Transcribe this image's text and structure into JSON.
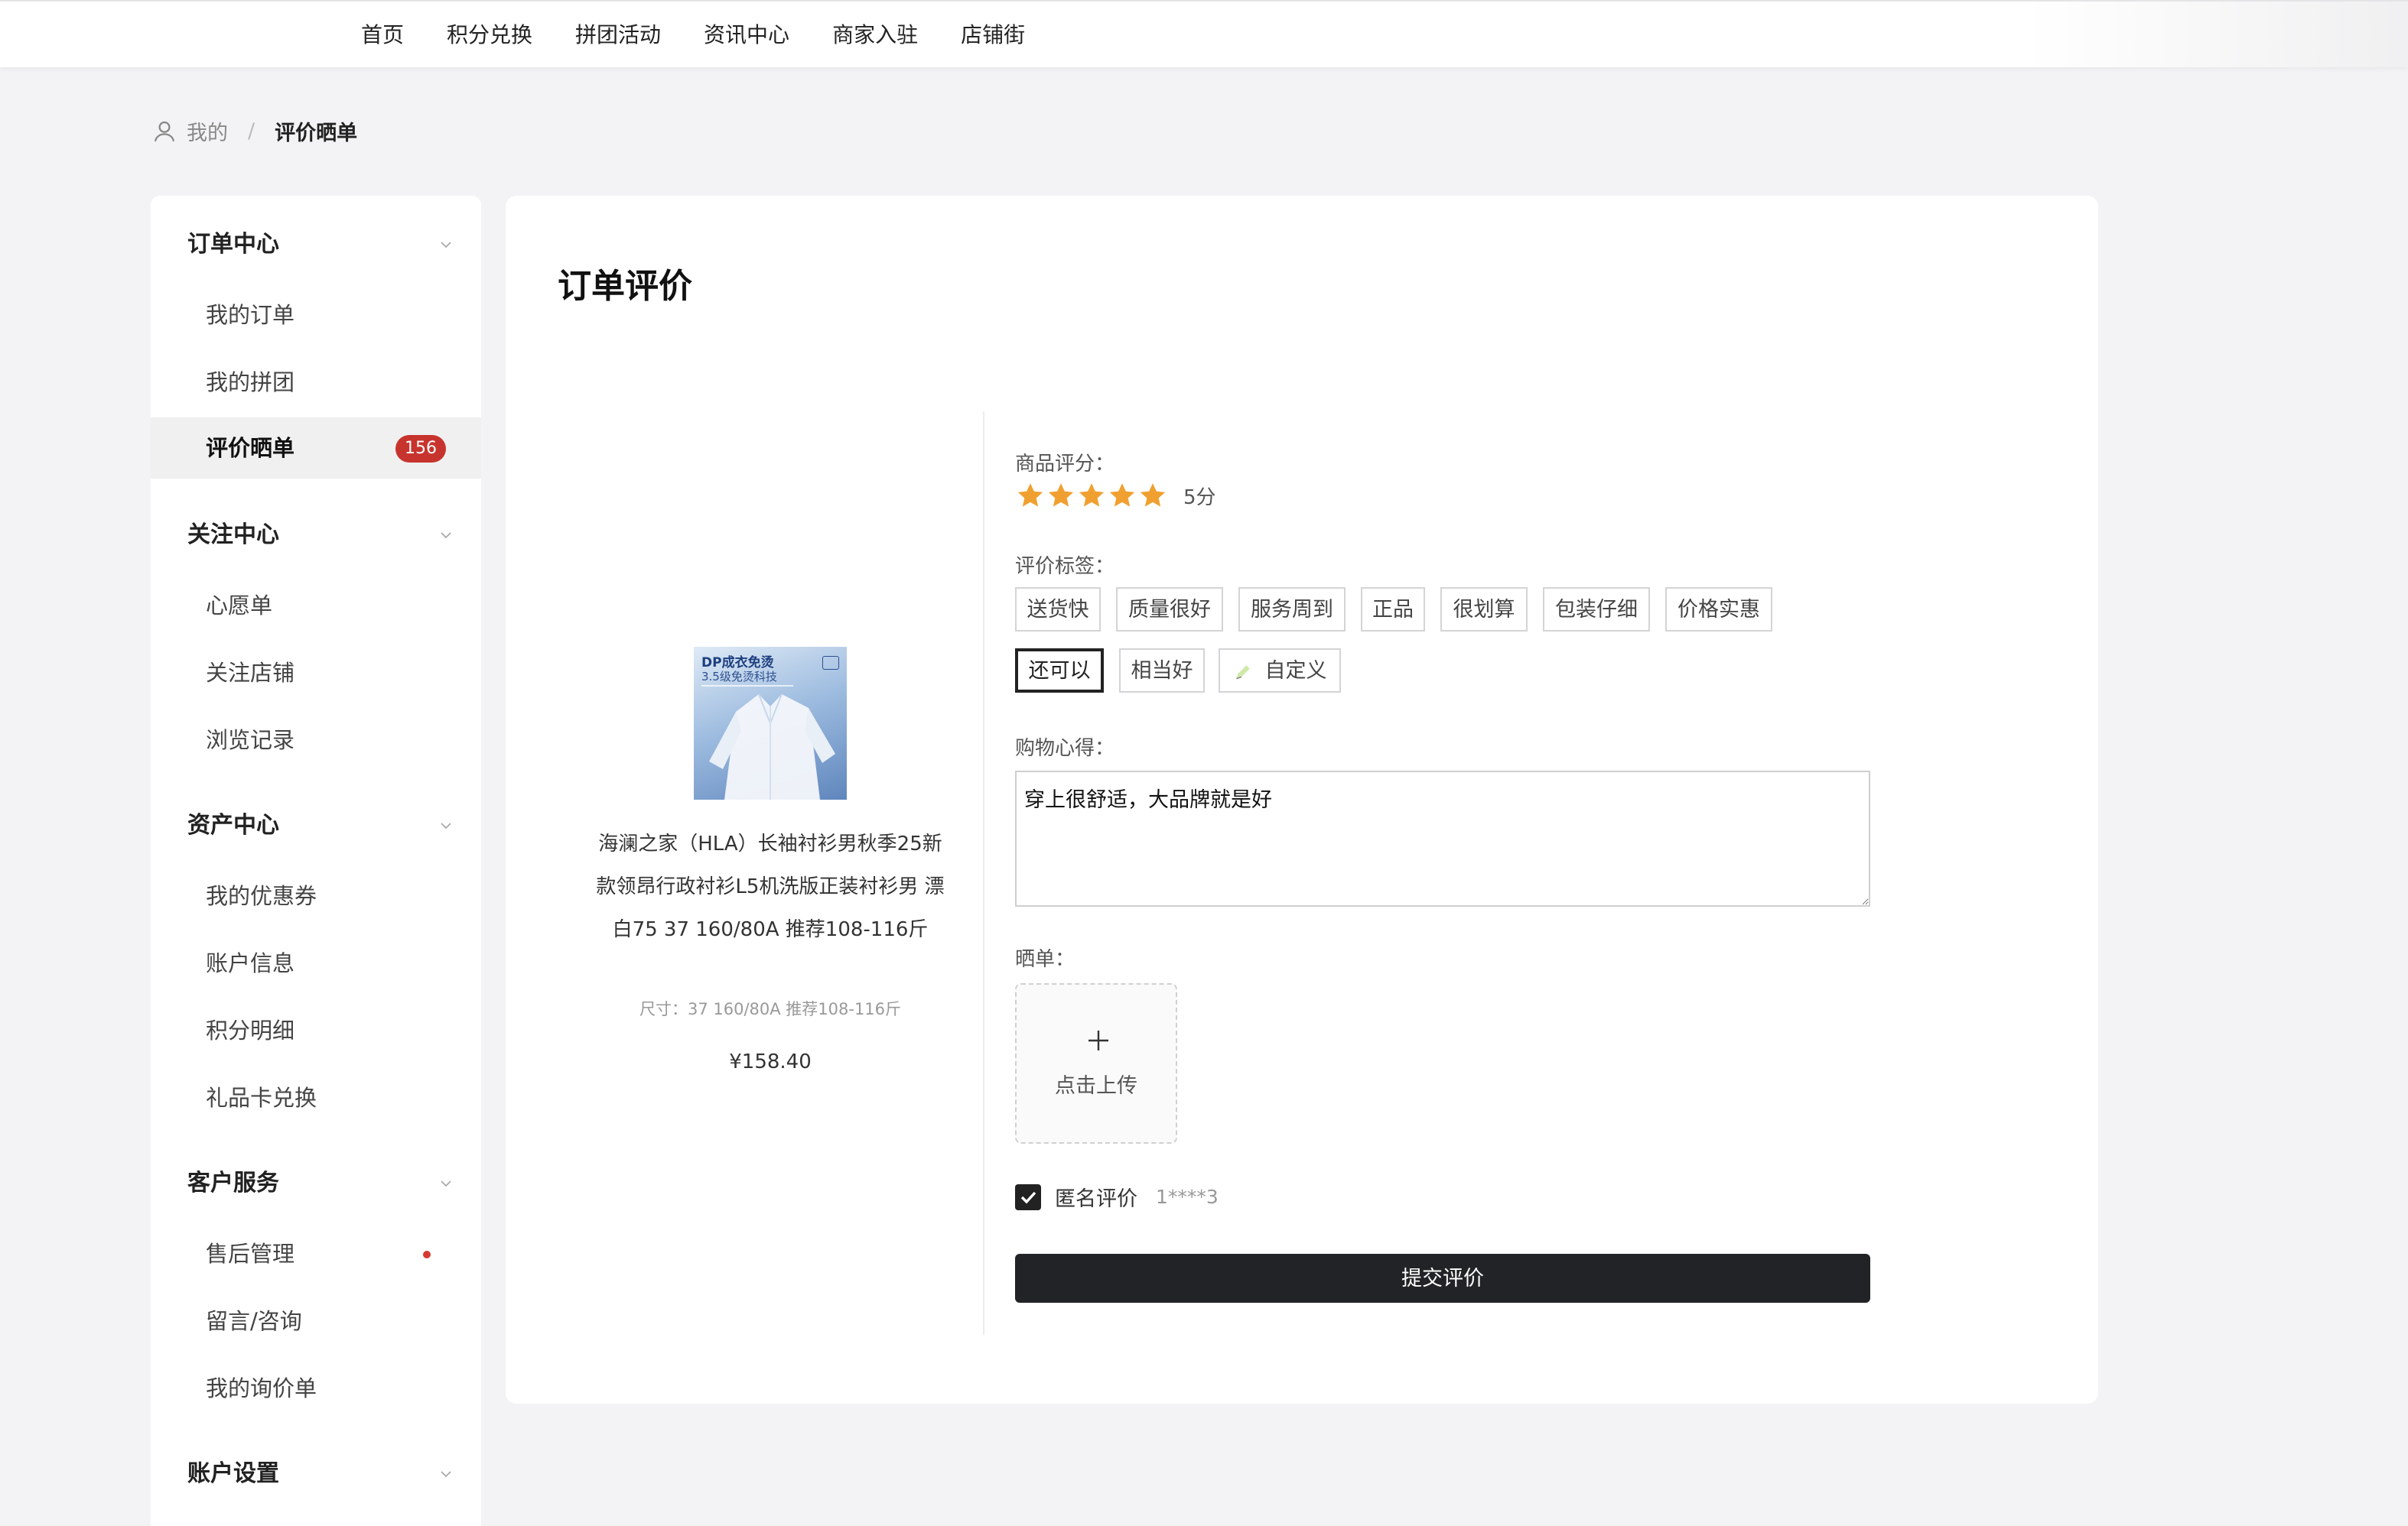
{
  "topnav": {
    "items": [
      "首页",
      "积分兑换",
      "拼团活动",
      "资讯中心",
      "商家入驻",
      "店铺街"
    ]
  },
  "breadcrumb": {
    "parent": "我的",
    "separator": "/",
    "current": "评价晒单"
  },
  "sidebar": {
    "groups": [
      {
        "title": "订单中心",
        "items": [
          "我的订单",
          "我的拼团",
          "评价晒单"
        ]
      },
      {
        "title": "关注中心",
        "items": [
          "心愿单",
          "关注店铺",
          "浏览记录"
        ]
      },
      {
        "title": "资产中心",
        "items": [
          "我的优惠券",
          "账户信息",
          "积分明细",
          "礼品卡兑换"
        ]
      },
      {
        "title": "客户服务",
        "items": [
          "售后管理",
          "留言/咨询",
          "我的询价单"
        ]
      },
      {
        "title": "账户设置",
        "items": []
      }
    ],
    "active_item": "评价晒单",
    "badge_count": "156"
  },
  "main": {
    "title": "订单评价",
    "product": {
      "image_title": "DP成衣免烫",
      "image_subtitle": "3.5级免烫科技",
      "name": "海澜之家（HLA）长袖衬衫男秋季25新款领昂行政衬衫L5机洗版正装衬衫男 漂白75 37 160/80A 推荐108-116斤",
      "size": "尺寸：37 160/80A 推荐108-116斤",
      "price": "¥158.40"
    },
    "rating": {
      "label": "商品评分：",
      "stars": 5,
      "score_text": "5分",
      "star_color": "#f0a030"
    },
    "tags": {
      "label": "评价标签：",
      "items": [
        "送货快",
        "质量很好",
        "服务周到",
        "正品",
        "很划算",
        "包装仔细",
        "价格实惠",
        "还可以",
        "相当好"
      ],
      "selected": "还可以",
      "custom_label": "自定义"
    },
    "review": {
      "label": "购物心得：",
      "value": "穿上很舒适，大品牌就是好"
    },
    "upload": {
      "label": "晒单：",
      "button_text": "点击上传"
    },
    "anonymous": {
      "checked": true,
      "label": "匿名评价",
      "user": "1****3"
    },
    "submit_label": "提交评价"
  }
}
